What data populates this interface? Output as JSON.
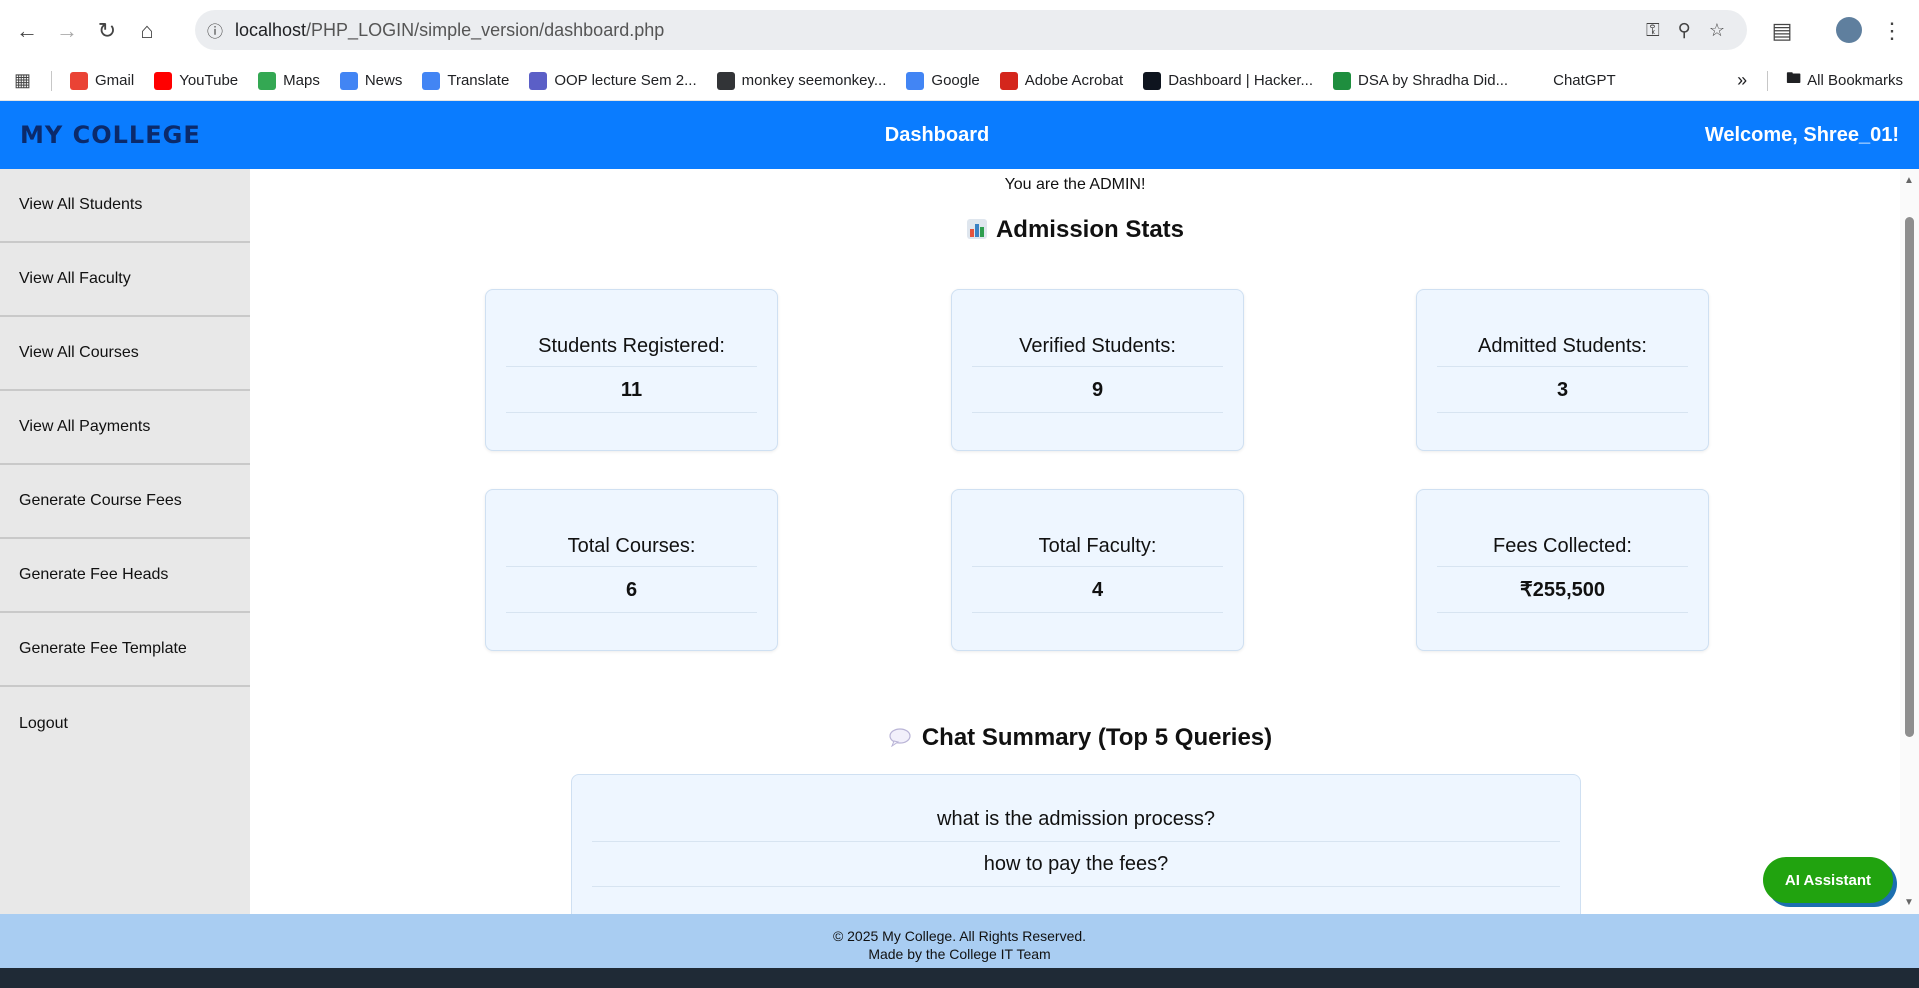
{
  "browser": {
    "url_host": "localhost",
    "url_path": "/PHP_LOGIN/simple_version/dashboard.php",
    "bookmarks": [
      {
        "label": "Gmail",
        "color": "#ea4335"
      },
      {
        "label": "YouTube",
        "color": "#ff0000"
      },
      {
        "label": "Maps",
        "color": "#34a853"
      },
      {
        "label": "News",
        "color": "#4285f4"
      },
      {
        "label": "Translate",
        "color": "#4285f4"
      },
      {
        "label": "OOP lecture Sem 2...",
        "color": "#5b5fc7"
      },
      {
        "label": "monkey seemonkey...",
        "color": "#323437"
      },
      {
        "label": "Google",
        "color": "#4285f4"
      },
      {
        "label": "Adobe Acrobat",
        "color": "#d4261c"
      },
      {
        "label": "Dashboard | Hacker...",
        "color": "#0e141e"
      },
      {
        "label": "DSA by Shradha Did...",
        "color": "#1e8e3e"
      },
      {
        "label": "ChatGPT",
        "color": "#ffffff"
      }
    ],
    "all_bookmarks": "All Bookmarks"
  },
  "header": {
    "logo": "MY COLLEGE",
    "title": "Dashboard",
    "welcome_prefix": "Welcome, ",
    "username": "Shree_01!"
  },
  "sidebar": {
    "items": [
      {
        "label": "View All Students"
      },
      {
        "label": "View All Faculty"
      },
      {
        "label": "View All Courses"
      },
      {
        "label": "View All Payments"
      },
      {
        "label": "Generate Course Fees"
      },
      {
        "label": "Generate Fee Heads"
      },
      {
        "label": "Generate Fee Template"
      },
      {
        "label": "Logout"
      }
    ]
  },
  "main": {
    "admin_note": "You are the ADMIN!",
    "stats_title": "Admission Stats",
    "stats": [
      {
        "label": "Students Registered:",
        "value": "11"
      },
      {
        "label": "Verified Students:",
        "value": "9"
      },
      {
        "label": "Admitted Students:",
        "value": "3"
      },
      {
        "label": "Total Courses:",
        "value": "6"
      },
      {
        "label": "Total Faculty:",
        "value": "4"
      },
      {
        "label": "Fees Collected:",
        "value": "₹255,500"
      }
    ],
    "chat_title": "Chat Summary (Top 5 Queries)",
    "chat_queries": [
      "what is the admission process?",
      "how to pay the fees?"
    ]
  },
  "ai_button": "AI Assistant",
  "footer": {
    "line1": "© 2025 My College. All Rights Reserved.",
    "line2": "Made by the College IT Team"
  },
  "colors": {
    "header_bg": "#0a7cff",
    "footer_bg": "#a9cdf2",
    "ai_button": "#21a30f"
  }
}
